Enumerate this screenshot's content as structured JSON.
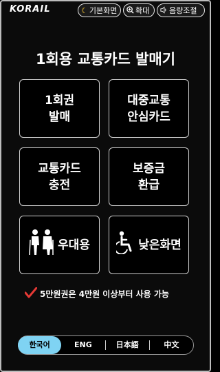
{
  "header": {
    "logo": "KORAIL",
    "basic_screen": "기본화면",
    "zoom": "확대",
    "volume": "음량조절"
  },
  "main": {
    "title": "1회용 교통카드 발매기",
    "buttons": {
      "single_ticket": [
        "1회권",
        "발매"
      ],
      "transit_card": [
        "대중교통",
        "안심카드"
      ],
      "charge": [
        "교통카드",
        "충전"
      ],
      "refund": [
        "보증금",
        "환급"
      ],
      "senior": "우대용",
      "low_screen": "낮은화면"
    },
    "notice": "5만원권은 4만원 이상부터 사용 가능"
  },
  "languages": {
    "items": [
      "한국어",
      "ENG",
      "日本語",
      "中文"
    ],
    "active": "한국어"
  },
  "colors": {
    "background": "#000000",
    "accent_language": "#7fd3f3",
    "check_red": "#e53935",
    "moon_yellow": "#f4c430"
  },
  "icons": [
    "moon-icon",
    "magnifier-plus-icon",
    "speaker-icon",
    "seniors-icon",
    "wheelchair-icon",
    "checkmark-icon"
  ]
}
